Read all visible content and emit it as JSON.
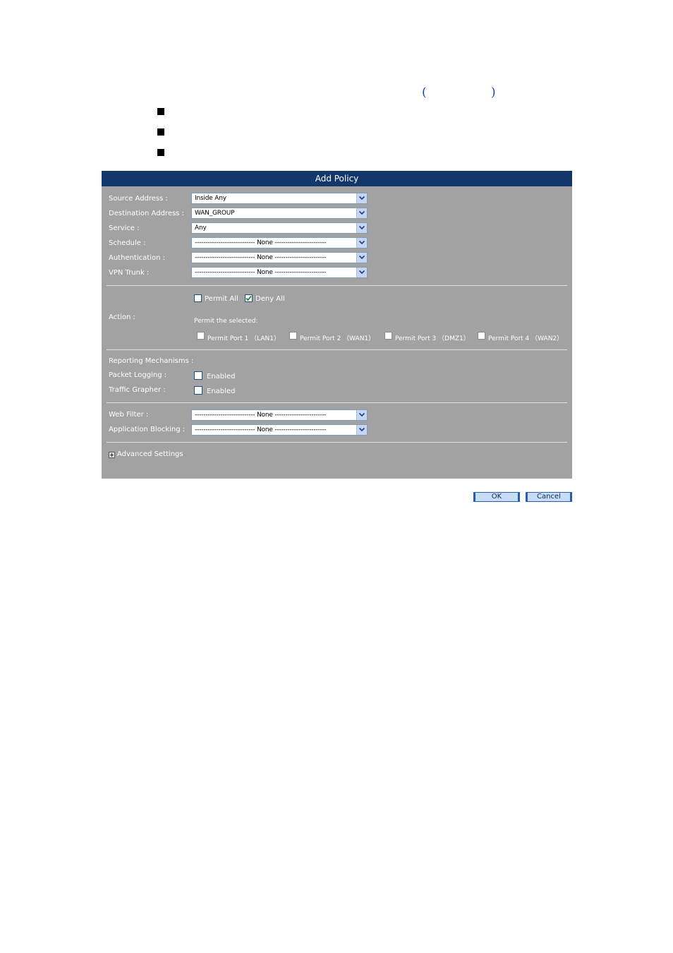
{
  "header": {
    "paren_open": "(",
    "paren_close": ")"
  },
  "dialog": {
    "title": "Add Policy",
    "fields": {
      "source_address": {
        "label": "Source Address :",
        "value": "Inside Any"
      },
      "destination_address": {
        "label": "Destination Address :",
        "value": "WAN_GROUP"
      },
      "service": {
        "label": "Service :",
        "value": "Any"
      },
      "schedule": {
        "label": "Schedule :",
        "value": "---------------------------- None ------------------------"
      },
      "authentication": {
        "label": "Authentication :",
        "value": "---------------------------- None ------------------------"
      },
      "vpn_trunk": {
        "label": "VPN Trunk :",
        "value": "---------------------------- None ------------------------"
      }
    },
    "action": {
      "label": "Action :",
      "permit_all": {
        "label": "Permit All",
        "checked": false
      },
      "deny_all": {
        "label": "Deny All",
        "checked": true
      },
      "permit_selected_label": "Permit the selected:",
      "ports": [
        {
          "label": "Permit Port  1 （LAN1）",
          "checked": false
        },
        {
          "label": "Permit Port  2 （WAN1）",
          "checked": false
        },
        {
          "label": "Permit Port  3 （DMZ1）",
          "checked": false
        },
        {
          "label": "Permit Port  4 （WAN2）",
          "checked": false
        }
      ]
    },
    "reporting": {
      "label": "Reporting Mechanisms :",
      "packet_logging": {
        "label": "Packet Logging :",
        "option": "Enabled",
        "checked": false
      },
      "traffic_grapher": {
        "label": "Traffic Grapher :",
        "option": "Enabled",
        "checked": false
      }
    },
    "web_filter": {
      "label": "Web Filter :",
      "value": "---------------------------- None ------------------------"
    },
    "application_blocking": {
      "label": "Application Blocking :",
      "value": "---------------------------- None ------------------------"
    },
    "advanced_settings": {
      "icon": "plus-box-icon",
      "label": "Advanced Settings"
    }
  },
  "buttons": {
    "ok": "OK",
    "cancel": "Cancel"
  },
  "colors": {
    "title_bar": "#13376b",
    "panel": "#a2a2a2",
    "dropdown_arrow": "#c6d6f2",
    "check_mark": "#2c8a2c"
  }
}
